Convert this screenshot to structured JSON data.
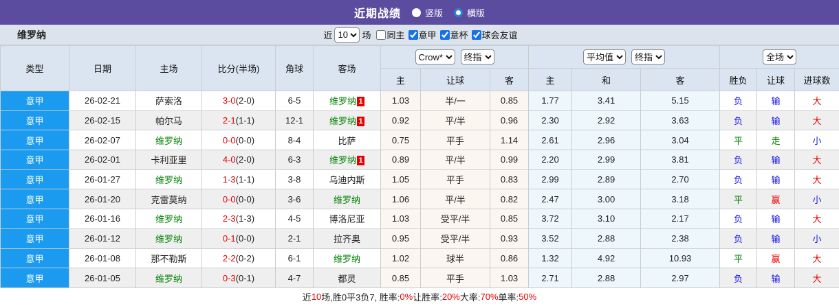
{
  "colors": {
    "accent_purple": "#5B4C9F",
    "league_blue": "#1B9BF0",
    "focus_team_green": "#008000",
    "score_red": "#E60000",
    "loss_blue": "#1414E6",
    "win_red": "#E60000",
    "draw_green": "#008000",
    "header_bg": "#DBE5F1",
    "odds_bg": "#FBF7F0",
    "avg_bg": "#EDF7FC"
  },
  "topbar": {
    "title": "近期战绩",
    "radio_vertical": "竖版",
    "radio_horizontal": "横版"
  },
  "filter": {
    "team": "维罗纳",
    "near_label": "近",
    "matches_value": "10",
    "matches_label": "场",
    "checkboxes": [
      {
        "label": "同主",
        "checked": false
      },
      {
        "label": "意甲",
        "checked": true
      },
      {
        "label": "意杯",
        "checked": true
      },
      {
        "label": "球会友谊",
        "checked": true
      }
    ]
  },
  "table": {
    "left_columns": [
      "类型",
      "日期",
      "主场",
      "比分(半场)",
      "角球",
      "客场"
    ],
    "odds_group": {
      "selects": [
        "Crow*",
        "终指"
      ],
      "columns": [
        "主",
        "让球",
        "客"
      ]
    },
    "avg_group": {
      "selects": [
        "平均值",
        "终指"
      ],
      "columns": [
        "主",
        "和",
        "客"
      ]
    },
    "result_group": {
      "selects": [
        "全场"
      ],
      "columns": [
        "胜负",
        "让球",
        "进球数"
      ]
    },
    "rows": [
      {
        "league": "意甲",
        "date": "26-02-21",
        "home": {
          "name": "萨索洛",
          "is_focus": false
        },
        "score": {
          "full": "3-0",
          "half": "(2-0)"
        },
        "corners": "6-5",
        "away": {
          "name": "维罗纳",
          "is_focus": true,
          "red_cards": "1"
        },
        "odds": [
          "1.03",
          "半/一",
          "0.85"
        ],
        "avg": [
          "1.77",
          "3.41",
          "5.15"
        ],
        "outcome": [
          {
            "text": "负",
            "color": "blue"
          },
          {
            "text": "输",
            "color": "blue"
          },
          {
            "text": "大",
            "color": "red"
          }
        ]
      },
      {
        "league": "意甲",
        "date": "26-02-15",
        "home": {
          "name": "帕尔马",
          "is_focus": false
        },
        "score": {
          "full": "2-1",
          "half": "(1-1)"
        },
        "corners": "12-1",
        "away": {
          "name": "维罗纳",
          "is_focus": true,
          "red_cards": "1"
        },
        "odds": [
          "0.92",
          "平/半",
          "0.96"
        ],
        "avg": [
          "2.30",
          "2.92",
          "3.63"
        ],
        "outcome": [
          {
            "text": "负",
            "color": "blue"
          },
          {
            "text": "输",
            "color": "blue"
          },
          {
            "text": "大",
            "color": "red"
          }
        ]
      },
      {
        "league": "意甲",
        "date": "26-02-07",
        "home": {
          "name": "维罗纳",
          "is_focus": true
        },
        "score": {
          "full": "0-0",
          "half": "(0-0)"
        },
        "corners": "8-4",
        "away": {
          "name": "比萨",
          "is_focus": false
        },
        "odds": [
          "0.75",
          "平手",
          "1.14"
        ],
        "avg": [
          "2.61",
          "2.96",
          "3.04"
        ],
        "outcome": [
          {
            "text": "平",
            "color": "green"
          },
          {
            "text": "走",
            "color": "green"
          },
          {
            "text": "小",
            "color": "blue"
          }
        ]
      },
      {
        "league": "意甲",
        "date": "26-02-01",
        "home": {
          "name": "卡利亚里",
          "is_focus": false
        },
        "score": {
          "full": "4-0",
          "half": "(2-0)"
        },
        "corners": "6-3",
        "away": {
          "name": "维罗纳",
          "is_focus": true,
          "red_cards": "1"
        },
        "odds": [
          "0.89",
          "平/半",
          "0.99"
        ],
        "avg": [
          "2.20",
          "2.99",
          "3.81"
        ],
        "outcome": [
          {
            "text": "负",
            "color": "blue"
          },
          {
            "text": "输",
            "color": "blue"
          },
          {
            "text": "大",
            "color": "red"
          }
        ]
      },
      {
        "league": "意甲",
        "date": "26-01-27",
        "home": {
          "name": "维罗纳",
          "is_focus": true
        },
        "score": {
          "full": "1-3",
          "half": "(1-1)"
        },
        "corners": "3-8",
        "away": {
          "name": "乌迪内斯",
          "is_focus": false
        },
        "odds": [
          "1.05",
          "平手",
          "0.83"
        ],
        "avg": [
          "2.99",
          "2.89",
          "2.70"
        ],
        "outcome": [
          {
            "text": "负",
            "color": "blue"
          },
          {
            "text": "输",
            "color": "blue"
          },
          {
            "text": "大",
            "color": "red"
          }
        ]
      },
      {
        "league": "意甲",
        "date": "26-01-20",
        "home": {
          "name": "克雷莫纳",
          "is_focus": false
        },
        "score": {
          "full": "0-0",
          "half": "(0-0)"
        },
        "corners": "3-6",
        "away": {
          "name": "维罗纳",
          "is_focus": true
        },
        "odds": [
          "1.06",
          "平/半",
          "0.82"
        ],
        "avg": [
          "2.47",
          "3.00",
          "3.18"
        ],
        "outcome": [
          {
            "text": "平",
            "color": "green"
          },
          {
            "text": "赢",
            "color": "red"
          },
          {
            "text": "小",
            "color": "blue"
          }
        ]
      },
      {
        "league": "意甲",
        "date": "26-01-16",
        "home": {
          "name": "维罗纳",
          "is_focus": true
        },
        "score": {
          "full": "2-3",
          "half": "(1-3)"
        },
        "corners": "4-5",
        "away": {
          "name": "博洛尼亚",
          "is_focus": false
        },
        "odds": [
          "1.03",
          "受平/半",
          "0.85"
        ],
        "avg": [
          "3.72",
          "3.10",
          "2.17"
        ],
        "outcome": [
          {
            "text": "负",
            "color": "blue"
          },
          {
            "text": "输",
            "color": "blue"
          },
          {
            "text": "大",
            "color": "red"
          }
        ]
      },
      {
        "league": "意甲",
        "date": "26-01-12",
        "home": {
          "name": "维罗纳",
          "is_focus": true
        },
        "score": {
          "full": "0-1",
          "half": "(0-0)"
        },
        "corners": "2-1",
        "away": {
          "name": "拉齐奥",
          "is_focus": false
        },
        "odds": [
          "0.95",
          "受平/半",
          "0.93"
        ],
        "avg": [
          "3.52",
          "2.88",
          "2.38"
        ],
        "outcome": [
          {
            "text": "负",
            "color": "blue"
          },
          {
            "text": "输",
            "color": "blue"
          },
          {
            "text": "小",
            "color": "blue"
          }
        ]
      },
      {
        "league": "意甲",
        "date": "26-01-08",
        "home": {
          "name": "那不勒斯",
          "is_focus": false
        },
        "score": {
          "full": "2-2",
          "half": "(0-2)"
        },
        "corners": "6-1",
        "away": {
          "name": "维罗纳",
          "is_focus": true
        },
        "odds": [
          "1.02",
          "球半",
          "0.86"
        ],
        "avg": [
          "1.32",
          "4.92",
          "10.93"
        ],
        "outcome": [
          {
            "text": "平",
            "color": "green"
          },
          {
            "text": "赢",
            "color": "red"
          },
          {
            "text": "大",
            "color": "red"
          }
        ]
      },
      {
        "league": "意甲",
        "date": "26-01-05",
        "home": {
          "name": "维罗纳",
          "is_focus": true
        },
        "score": {
          "full": "0-3",
          "half": "(0-1)"
        },
        "corners": "4-7",
        "away": {
          "name": "都灵",
          "is_focus": false
        },
        "odds": [
          "0.85",
          "平手",
          "1.03"
        ],
        "avg": [
          "2.71",
          "2.88",
          "2.97"
        ],
        "outcome": [
          {
            "text": "负",
            "color": "blue"
          },
          {
            "text": "输",
            "color": "blue"
          },
          {
            "text": "大",
            "color": "red"
          }
        ]
      }
    ]
  },
  "footer": {
    "segments": [
      {
        "text": "近",
        "red": false
      },
      {
        "text": "10",
        "red": true
      },
      {
        "text": "场,胜0平3负7, 胜率:",
        "red": false
      },
      {
        "text": "0%",
        "red": true
      },
      {
        "text": " 让胜率:",
        "red": false
      },
      {
        "text": "20%",
        "red": true
      },
      {
        "text": " 大率:",
        "red": false
      },
      {
        "text": "70%",
        "red": true
      },
      {
        "text": " 单率:",
        "red": false
      },
      {
        "text": "50%",
        "red": true
      }
    ]
  }
}
